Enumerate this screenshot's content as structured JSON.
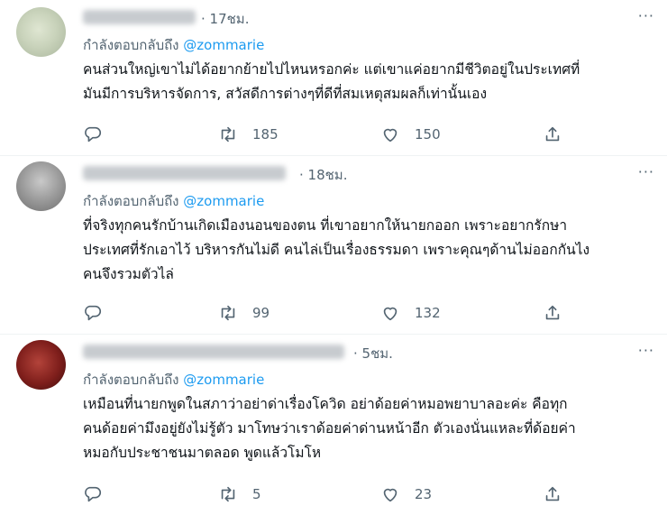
{
  "tweets": [
    {
      "time": "· 17ชม.",
      "reply_prefix": "กำลังตอบกลับถึง",
      "reply_handle": "@zommarie",
      "text": "คนส่วนใหญ่เขาไม่ได้อยากย้ายไปไหนหรอกค่ะ แต่เขาแค่อยากมีชีวิตอยู่ในประเทศที่\nมันมีการบริหารจัดการ, สวัสดีการต่างๆที่ดีที่สมเหตุสมผลก็เท่านั้นเอง",
      "retweets": "185",
      "likes": "150"
    },
    {
      "time": "· 18ชม.",
      "reply_prefix": "กำลังตอบกลับถึง",
      "reply_handle": "@zommarie",
      "text": "ที่จริงทุกคนรักบ้านเกิดเมืองนอนของตน ที่เขาอยากให้นายกออก เพราะอยากรักษา\nประเทศที่รักเอาไว้ บริหารกันไม่ดี คนไล่เป็นเรื่องธรรมดา เพราะคุณๆด้านไม่ออกกันไง\nคนจึงรวมตัวไล่",
      "retweets": "99",
      "likes": "132"
    },
    {
      "time": "· 5ชม.",
      "reply_prefix": "กำลังตอบกลับถึง",
      "reply_handle": "@zommarie",
      "text": "เหมือนที่นายกพูดในสภาว่าอย่าด่าเรื่องโควิด อย่าด้อยค่าหมอพยาบาลอะค่ะ คือทุก\nคนด้อยค่ามึงอยู่ยังไม่รู้ตัว มาโทษว่าเราด้อยค่าด่านหน้าอีก ตัวเองนั่นแหละที่ด้อยค่า\nหมอกับประชาชนมาตลอด พูดแล้วโมโห",
      "retweets": "5",
      "likes": "23"
    }
  ],
  "more_label": "···"
}
